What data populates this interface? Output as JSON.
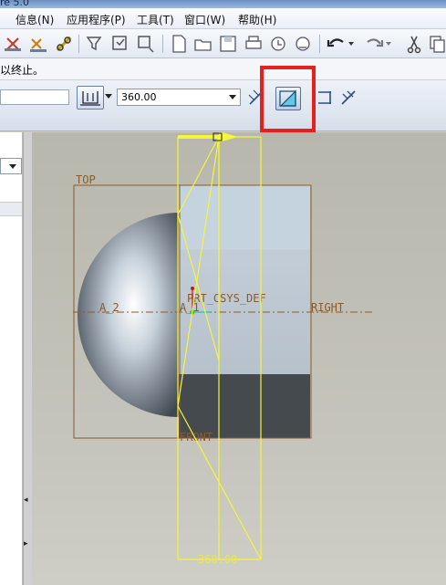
{
  "window": {
    "title_fragment": "re 5.0"
  },
  "menu": {
    "items": [
      {
        "label": "信息(N)"
      },
      {
        "label": "应用程序(P)"
      },
      {
        "label": "工具(T)"
      },
      {
        "label": "窗口(W)"
      },
      {
        "label": "帮助(H)"
      }
    ]
  },
  "message": {
    "text": "以终止。"
  },
  "dashboard": {
    "depth_value": "360.00"
  },
  "model": {
    "datum_top": "TOP",
    "datum_right": "RIGHT",
    "datum_front": "FRONT",
    "csys": "PRT_CSYS_DEF",
    "axis_a2": "A_2",
    "axis_a1": "A_1",
    "dimension": "360.00"
  },
  "colors": {
    "highlight": "#e8201d",
    "sketch": "#f5f53b",
    "datum": "#8b5a2b"
  }
}
